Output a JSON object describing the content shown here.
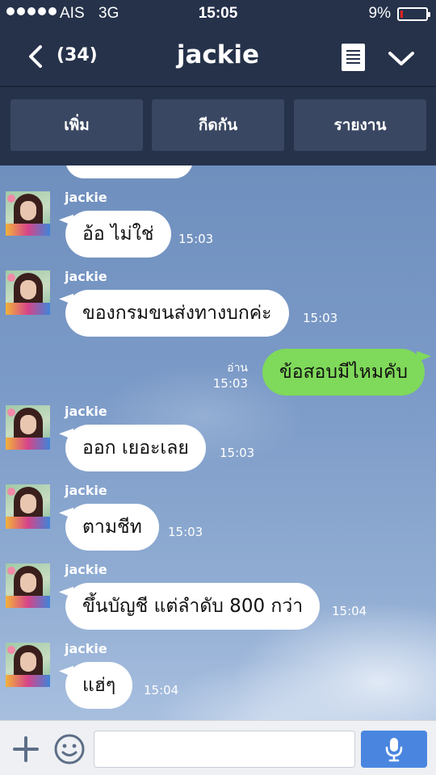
{
  "status_bar": {
    "carrier": "AIS",
    "network": "3G",
    "time": "15:05",
    "battery": "9%",
    "battery_level": 0.09,
    "battery_color": "#e22222"
  },
  "nav": {
    "back_icon": "chevron-left-icon",
    "unread_count": "(34)",
    "title": "jackie",
    "notes_icon": "notes-icon",
    "menu_icon": "chevron-down-icon"
  },
  "actions": [
    {
      "label": "เพิ่ม"
    },
    {
      "label": "กีดกัน"
    },
    {
      "label": "รายงาน"
    }
  ],
  "messages": [
    {
      "sender": "jackie",
      "text": "อ้อ ไม่ใช่",
      "time": "15:03"
    },
    {
      "sender": "jackie",
      "text": "ของกรมขนส่งทางบกค่ะ",
      "time": "15:03"
    },
    {
      "sender": "me",
      "text": "ข้อสอบมีไหมคับ",
      "read": "อ่าน",
      "time": "15:03"
    },
    {
      "sender": "jackie",
      "text": "ออก เยอะเลย",
      "time": "15:03"
    },
    {
      "sender": "jackie",
      "text": "ตามชีท",
      "time": "15:03"
    },
    {
      "sender": "jackie",
      "text": "ขึ้นบัญชี แต่ลำดับ 800 กว่า",
      "time": "15:04"
    },
    {
      "sender": "jackie",
      "text": "แฮ่ๆ",
      "time": "15:04"
    }
  ],
  "input_bar": {
    "plus_icon": "plus-icon",
    "emoji_icon": "smiley-icon",
    "message_value": "",
    "mic_icon": "microphone-icon"
  },
  "colors": {
    "header_bg": "#26324a",
    "action_button_bg": "#3a4762",
    "outgoing_bubble": "#7fd95a",
    "incoming_bubble": "#ffffff",
    "mic_button": "#4a86e0"
  }
}
